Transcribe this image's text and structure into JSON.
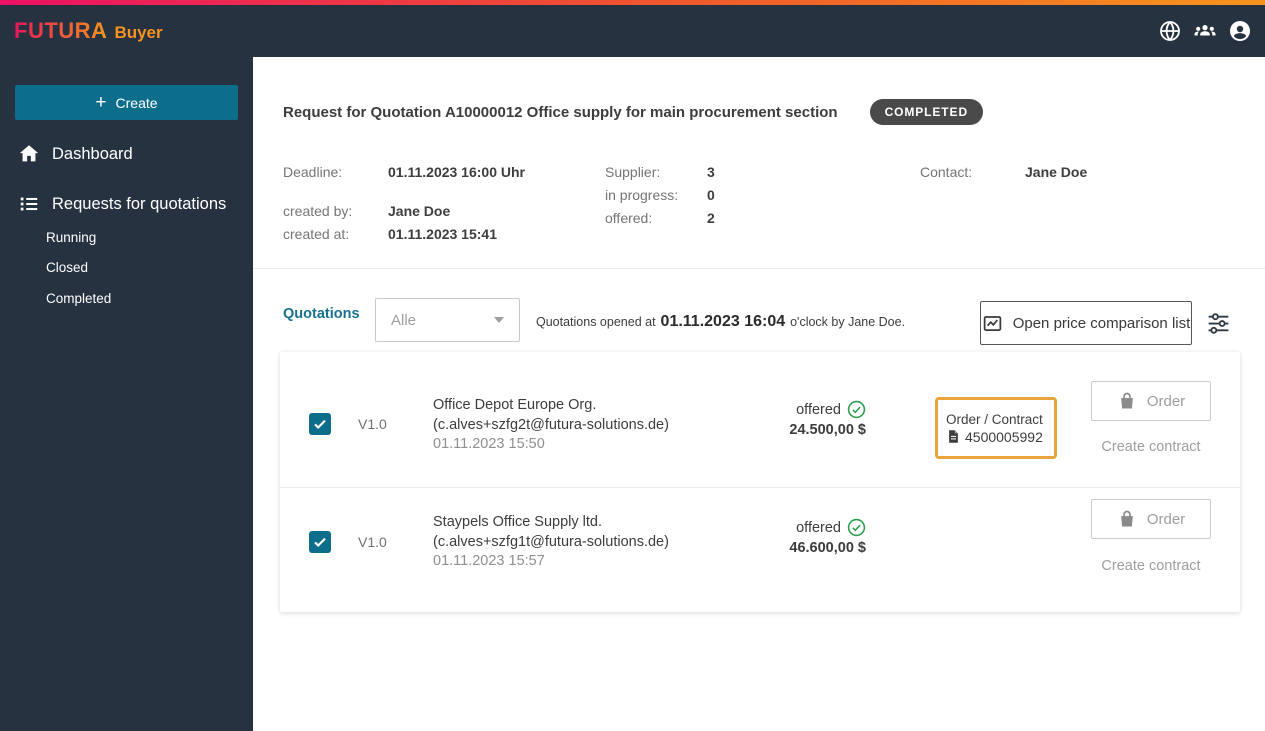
{
  "colors": {
    "navy": "#263240",
    "accent_teal": "#0d6e8c",
    "gradient_start": "#ec1164",
    "gradient_end": "#f7941d",
    "badge_bg": "#4a4a4a",
    "status_green": "#2e9e4f",
    "highlight_orange": "#e9a43c",
    "quotations_label_teal": "#17718f"
  },
  "header": {
    "logo_primary": "FUTURA",
    "logo_secondary": "Buyer",
    "icons": [
      "globe-icon",
      "users-icon",
      "account-icon"
    ]
  },
  "sidebar": {
    "create_plus": "+",
    "create_label": "Create",
    "items": [
      {
        "label": "Dashboard",
        "icon": "home-icon"
      },
      {
        "label": "Requests for quotations",
        "icon": "list-icon"
      }
    ],
    "subitems": [
      {
        "label": "Running"
      },
      {
        "label": "Closed"
      },
      {
        "label": "Completed"
      }
    ]
  },
  "request": {
    "title": "Request for Quotation A10000012 Office supply for main procurement section",
    "status_badge": "COMPLETED",
    "meta_left": [
      {
        "label": "Deadline:",
        "value": "01.11.2023 16:00 Uhr"
      },
      {
        "label": "created by:",
        "value": "Jane Doe"
      },
      {
        "label": "created at:",
        "value": "01.11.2023 15:41"
      }
    ],
    "meta_mid": [
      {
        "label": "Supplier:",
        "value": "3"
      },
      {
        "label": "in progress:",
        "value": "0"
      },
      {
        "label": "offered:",
        "value": "2"
      }
    ],
    "meta_right": [
      {
        "label": "Contact:",
        "value": "Jane Doe"
      }
    ]
  },
  "quotations": {
    "section_label": "Quotations",
    "filter_value": "Alle",
    "opened_prefix": "Quotations opened at",
    "opened_time": "01.11.2023 16:04",
    "opened_suffix": "o'clock by Jane Doe.",
    "compare_button_label": "Open price comparison list",
    "rows": [
      {
        "checked": true,
        "version": "V1.0",
        "supplier": "Office Depot Europe Org.",
        "email": "(c.alves+szfg2t@futura-solutions.de)",
        "date": "01.11.2023 15:50",
        "status": "offered",
        "price": "24.500,00 $",
        "order_contract_label": "Order / Contract",
        "order_contract_number": "4500005992",
        "order_button_label": "Order",
        "create_contract_label": "Create contract"
      },
      {
        "checked": true,
        "version": "V1.0",
        "supplier": "Staypels Office Supply ltd.",
        "email": "(c.alves+szfg1t@futura-solutions.de)",
        "date": "01.11.2023 15:57",
        "status": "offered",
        "price": "46.600,00 $",
        "order_button_label": "Order",
        "create_contract_label": "Create contract"
      }
    ]
  }
}
